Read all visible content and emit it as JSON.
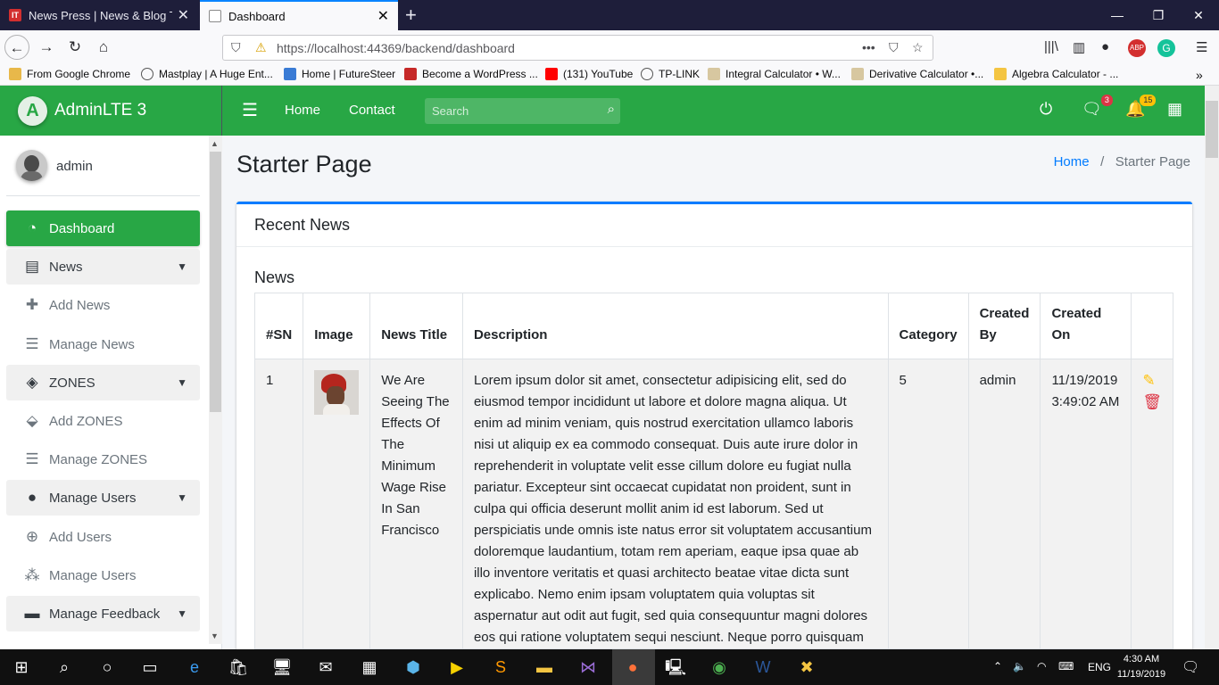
{
  "browser": {
    "tabs": [
      {
        "title": "News Press | News & Blog Tem",
        "favicon": "IT"
      },
      {
        "title": "Dashboard"
      }
    ],
    "url": "https://localhost:44369/backend/dashboard",
    "bookmarks": [
      "From Google Chrome",
      "Mastplay | A Huge Ent...",
      "Home | FutureSteer",
      "Become a WordPress ...",
      "(131) YouTube",
      "TP-LINK",
      "Integral Calculator • W...",
      "Derivative Calculator •...",
      "Algebra Calculator - ..."
    ]
  },
  "brand": {
    "logo": "A",
    "name": "AdminLTE 3"
  },
  "topnav": {
    "links": [
      "Home",
      "Contact"
    ],
    "search_placeholder": "Search",
    "messages_count": "3",
    "notifications_count": "15"
  },
  "sidebar": {
    "user": "admin",
    "items": [
      {
        "label": "Dashboard",
        "icon": "dashboard-icon"
      },
      {
        "label": "News",
        "icon": "newspaper-icon"
      },
      {
        "label": "Add News",
        "icon": "plus-icon"
      },
      {
        "label": "Manage News",
        "icon": "list-icon"
      },
      {
        "label": "ZONES",
        "icon": "layers-icon"
      },
      {
        "label": "Add ZONES",
        "icon": "tags-icon"
      },
      {
        "label": "Manage ZONES",
        "icon": "list-icon"
      },
      {
        "label": "Manage Users",
        "icon": "user-icon"
      },
      {
        "label": "Add Users",
        "icon": "user-plus-icon"
      },
      {
        "label": "Manage Users",
        "icon": "users-icon"
      },
      {
        "label": "Manage Feedback",
        "icon": "comment-icon"
      }
    ]
  },
  "page": {
    "title": "Starter Page",
    "breadcrumb": [
      "Home",
      "Starter Page"
    ],
    "card_title": "Recent News",
    "table_title": "News",
    "columns": [
      "#SN",
      "Image",
      "News Title",
      "Description",
      "Category",
      "Created By",
      "Created On"
    ],
    "rows": [
      {
        "sn": "1",
        "title": "We Are Seeing The Effects Of The Minimum Wage Rise In San Francisco",
        "description": "Lorem ipsum dolor sit amet, consectetur adipisicing elit, sed do eiusmod tempor incididunt ut labore et dolore magna aliqua. Ut enim ad minim veniam, quis nostrud exercitation ullamco laboris nisi ut aliquip ex ea commodo consequat. Duis aute irure dolor in reprehenderit in voluptate velit esse cillum dolore eu fugiat nulla pariatur. Excepteur sint occaecat cupidatat non proident, sunt in culpa qui officia deserunt mollit anim id est laborum. Sed ut perspiciatis unde omnis iste natus error sit voluptatem accusantium doloremque laudantium, totam rem aperiam, eaque ipsa quae ab illo inventore veritatis et quasi architecto beatae vitae dicta sunt explicabo. Nemo enim ipsam voluptatem quia voluptas sit aspernatur aut odit aut fugit, sed quia consequuntur magni dolores eos qui ratione voluptatem sequi nesciunt. Neque porro quisquam",
        "category": "5",
        "created_by": "admin",
        "created_on": "11/19/2019 3:49:02 AM"
      }
    ]
  },
  "taskbar": {
    "language": "ENG",
    "time": "4:30 AM",
    "date": "11/19/2019"
  },
  "colors": {
    "accent": "#28a745",
    "link": "#007bff",
    "edit": "#ffc107",
    "delete": "#dc3545"
  }
}
